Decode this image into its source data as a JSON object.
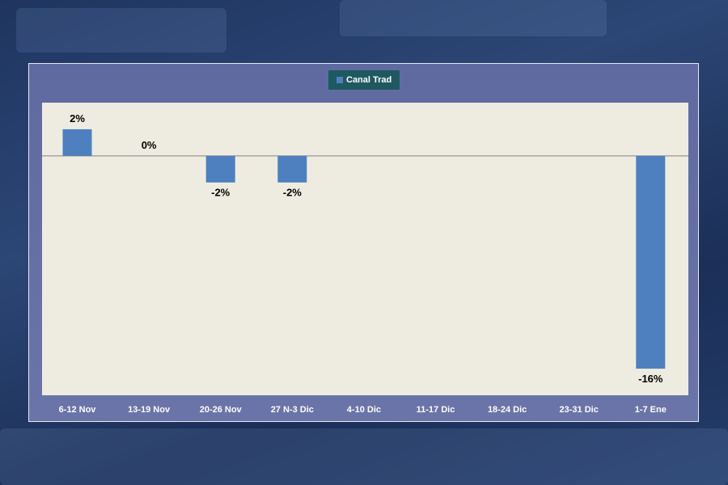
{
  "chart_data": {
    "type": "bar",
    "categories": [
      "6-12 Nov",
      "13-19 Nov",
      "20-26 Nov",
      "27 N-3 Dic",
      "4-10 Dic",
      "11-17 Dic",
      "18-24 Dic",
      "23-31 Dic",
      "1-7 Ene"
    ],
    "series": [
      {
        "name": "Canal Trad",
        "values": [
          2,
          0,
          -2,
          -2,
          null,
          null,
          null,
          null,
          -16
        ],
        "labels": [
          "2%",
          "0%",
          "-2%",
          "-2%",
          "",
          "",
          "",
          "",
          "-16%"
        ]
      }
    ],
    "ylim": [
      -18,
      4
    ],
    "grid": false,
    "legend_position": "top-center"
  },
  "colors": {
    "bar": "#4e80bf",
    "plot_bg": "#eeece1",
    "panel_bg": "#6470a6",
    "legend_bg": "#1f5960",
    "axis_label": "#ffffff",
    "data_label": "#000000",
    "zero_line": "#808080"
  }
}
